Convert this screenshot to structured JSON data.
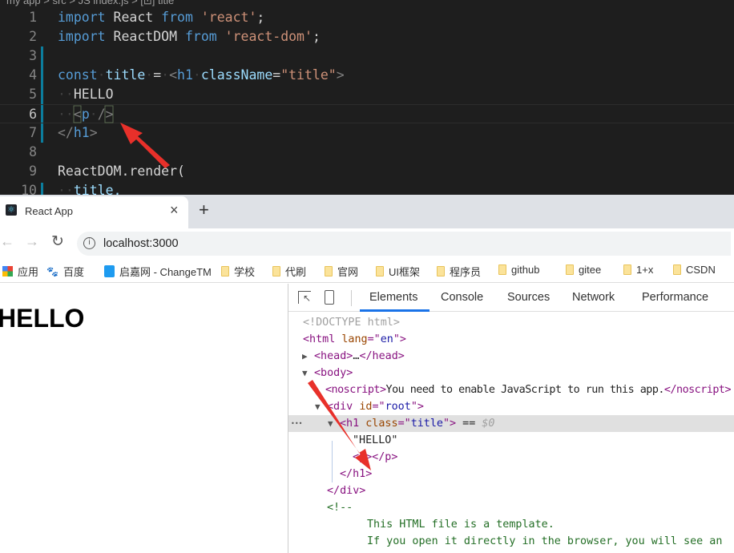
{
  "editor": {
    "breadcrumb": "my app > src > JS index.js > [⊡] title",
    "lines": [
      {
        "n": "1",
        "tokens": [
          [
            "import",
            "kw"
          ],
          [
            " ",
            "ws"
          ],
          [
            "React",
            "id"
          ],
          [
            " ",
            "ws"
          ],
          [
            "from",
            "kw"
          ],
          [
            " ",
            "ws"
          ],
          [
            "'react'",
            "str"
          ],
          [
            ";",
            "id"
          ]
        ]
      },
      {
        "n": "2",
        "tokens": [
          [
            "import",
            "kw"
          ],
          [
            " ",
            "ws"
          ],
          [
            "ReactDOM",
            "id"
          ],
          [
            " ",
            "ws"
          ],
          [
            "from",
            "kw"
          ],
          [
            " ",
            "ws"
          ],
          [
            "'react-dom'",
            "str"
          ],
          [
            ";",
            "id"
          ]
        ]
      },
      {
        "n": "3",
        "tokens": []
      },
      {
        "n": "4",
        "tokens": [
          [
            "const",
            "kw"
          ],
          [
            "·",
            "ws"
          ],
          [
            "title",
            "var"
          ],
          [
            "·",
            "ws"
          ],
          [
            "=",
            "id"
          ],
          [
            "·",
            "ws"
          ],
          [
            "<",
            "br"
          ],
          [
            "h1",
            "tag"
          ],
          [
            "·",
            "ws"
          ],
          [
            "className",
            "attr"
          ],
          [
            "=",
            "id"
          ],
          [
            "\"title\"",
            "str"
          ],
          [
            ">",
            "br"
          ]
        ]
      },
      {
        "n": "5",
        "tokens": [
          [
            "··",
            "ws"
          ],
          [
            "HELLO",
            "txt"
          ]
        ]
      },
      {
        "n": "6",
        "tokens": [
          [
            "··",
            "ws"
          ],
          [
            "<",
            "br"
          ],
          [
            "p",
            "tag"
          ],
          [
            "·",
            "ws"
          ],
          [
            "/>",
            "br"
          ]
        ]
      },
      {
        "n": "7",
        "tokens": [
          [
            "</",
            "br"
          ],
          [
            "h1",
            "tag"
          ],
          [
            ">",
            "br"
          ]
        ]
      },
      {
        "n": "8",
        "tokens": []
      },
      {
        "n": "9",
        "tokens": [
          [
            "ReactDOM",
            "id"
          ],
          [
            ".",
            "id"
          ],
          [
            "render",
            "id"
          ],
          [
            "(",
            "id"
          ]
        ]
      },
      {
        "n": "10",
        "tokens": [
          [
            "··",
            "ws"
          ],
          [
            "title,",
            "var"
          ]
        ]
      }
    ]
  },
  "browser": {
    "tab_title": "React App",
    "tab_close": "×",
    "new_tab": "+",
    "url": "localhost:3000",
    "bookmarks": [
      "应用",
      "百度",
      "启嘉网 - ChangeTM",
      "学校",
      "代刷",
      "官网",
      "UI框架",
      "程序员",
      "github",
      "gitee",
      "1+x",
      "CSDN"
    ]
  },
  "page": {
    "heading": "HELLO"
  },
  "devtools": {
    "tabs": [
      "Elements",
      "Console",
      "Sources",
      "Network",
      "Performance"
    ],
    "active_tab": "Elements",
    "dom": [
      {
        "indent": 0,
        "tri": "",
        "parts": [
          [
            "<!DOCTYPE html>",
            "g"
          ]
        ]
      },
      {
        "indent": 0,
        "tri": "",
        "parts": [
          [
            "<html ",
            "t"
          ],
          [
            "lang",
            "a"
          ],
          [
            "=\"",
            "t"
          ],
          [
            "en",
            "v"
          ],
          [
            "\">",
            "t"
          ]
        ]
      },
      {
        "indent": 0,
        "tri": "▶",
        "parts": [
          [
            "<head>",
            "t"
          ],
          [
            "…",
            "k"
          ],
          [
            "</head>",
            "t"
          ]
        ]
      },
      {
        "indent": 0,
        "tri": "▼",
        "parts": [
          [
            "<body>",
            "t"
          ]
        ]
      },
      {
        "indent": 2,
        "tri": "",
        "parts": [
          [
            "<noscript>",
            "t"
          ],
          [
            "You need to enable JavaScript to run this app.",
            "k"
          ],
          [
            "</noscript>",
            "t"
          ]
        ]
      },
      {
        "indent": 1,
        "tri": "▼",
        "parts": [
          [
            "<div ",
            "t"
          ],
          [
            "id",
            "a"
          ],
          [
            "=\"",
            "t"
          ],
          [
            "root",
            "v"
          ],
          [
            "\">",
            "t"
          ]
        ]
      },
      {
        "indent": 2,
        "tri": "▼",
        "sel": true,
        "parts": [
          [
            "<h1 ",
            "t"
          ],
          [
            "class",
            "a"
          ],
          [
            "=\"",
            "t"
          ],
          [
            "title",
            "v"
          ],
          [
            "\">",
            "t"
          ],
          [
            " == ",
            "k"
          ],
          [
            "$0",
            "g"
          ]
        ]
      },
      {
        "indent": 4,
        "tri": "",
        "parts": [
          [
            "\"HELLO\"",
            "k"
          ]
        ]
      },
      {
        "indent": 4,
        "tri": "",
        "parts": [
          [
            "<p></p>",
            "t"
          ]
        ]
      },
      {
        "indent": 3,
        "tri": "",
        "parts": [
          [
            "</h1>",
            "t"
          ]
        ]
      },
      {
        "indent": 2,
        "tri": "",
        "parts": [
          [
            "</div>",
            "t"
          ]
        ]
      },
      {
        "indent": 2,
        "tri": "",
        "parts": [
          [
            "<!--",
            "c"
          ]
        ]
      },
      {
        "indent": 6,
        "tri": "",
        "parts": [
          [
            "This HTML file is a template.",
            "c"
          ]
        ]
      },
      {
        "indent": 6,
        "tri": "",
        "parts": [
          [
            "If you open it directly in the browser, you will see an",
            "c"
          ]
        ]
      }
    ]
  },
  "annotation_color": "#e8302a"
}
